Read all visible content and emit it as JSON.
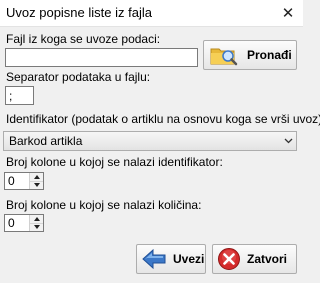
{
  "window": {
    "title": "Uvoz popisne liste iz fajla",
    "close_glyph": "✕"
  },
  "file": {
    "label": "Fajl iz koga se uvoze podaci:",
    "value": "",
    "browse_label": "Pronađi",
    "browse_icon": "folder-search-icon"
  },
  "separator": {
    "label": "Separator podataka u fajlu:",
    "value": ";"
  },
  "identifier": {
    "label": "Identifikator (podatak o artiklu na osnovu koga se vrši uvoz):",
    "selected": "Barkod artikla"
  },
  "id_column": {
    "label": "Broj kolone u kojoj se nalazi identifikator:",
    "value": "0"
  },
  "qty_column": {
    "label": "Broj kolone u kojoj se nalazi količina:",
    "value": "0"
  },
  "actions": {
    "import_label": "Uvezi",
    "import_icon": "arrow-left-icon",
    "close_label": "Zatvori",
    "close_icon": "cancel-icon"
  },
  "colors": {
    "accent_blue": "#3c78c8",
    "cancel_red": "#d42a2a",
    "folder_yellow": "#e8b93a"
  }
}
